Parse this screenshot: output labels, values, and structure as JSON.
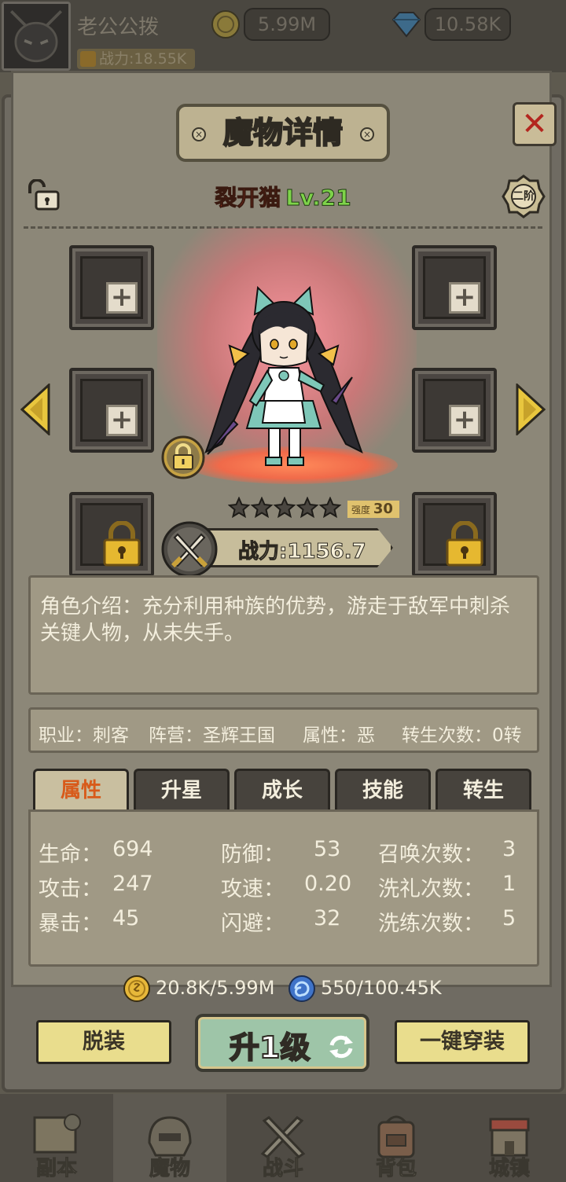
{
  "player": {
    "name": "老公公拨",
    "power": "战力:18.55K",
    "gold": "5.99M",
    "diamonds": "10.58K"
  },
  "panel": {
    "title": "魔物详情",
    "close": "✕"
  },
  "monster": {
    "name": "裂开猫",
    "level": "Lv.21",
    "rank": "二阶",
    "stars": 5,
    "strength_label": "强度",
    "strength_value": "30",
    "power": "战力:1156.7",
    "intro": "角色介绍：充分利用种族的优势，游走于敌军中刺杀关键人物，从未失手。"
  },
  "info": {
    "job": "职业：刺客",
    "faction": "阵营：圣辉王国",
    "attribute": "属性：恶",
    "reborn": "转生次数：0转"
  },
  "tabs": [
    "属性",
    "升星",
    "成长",
    "技能",
    "转生"
  ],
  "stats": {
    "hp_label": "生命：",
    "hp": "694",
    "atk_label": "攻击：",
    "atk": "247",
    "crit_label": "暴击：",
    "crit": "45",
    "def_label": "防御：",
    "def": "53",
    "spd_label": "攻速：",
    "spd": "0.20",
    "dodge_label": "闪避：",
    "dodge": "32",
    "summon_label": "召唤次数：",
    "summon": "3",
    "baptism_label": "洗礼次数：",
    "baptism": "1",
    "refine_label": "洗练次数：",
    "refine": "5"
  },
  "costs": {
    "gold": "20.8K/5.99M",
    "essence": "550/100.45K"
  },
  "buttons": {
    "unequip": "脱装",
    "levelup": "升1级",
    "equip_all": "一键穿装"
  },
  "nav": [
    "副本",
    "魔物",
    "战斗",
    "背包",
    "城镇"
  ],
  "colors": {
    "name_red": "#d63a24",
    "level_green": "#7ed34a",
    "active_tab_text": "#d85a1a",
    "button_yellow": "#e9dd8d",
    "levelup_green": "#9ec5a8"
  }
}
